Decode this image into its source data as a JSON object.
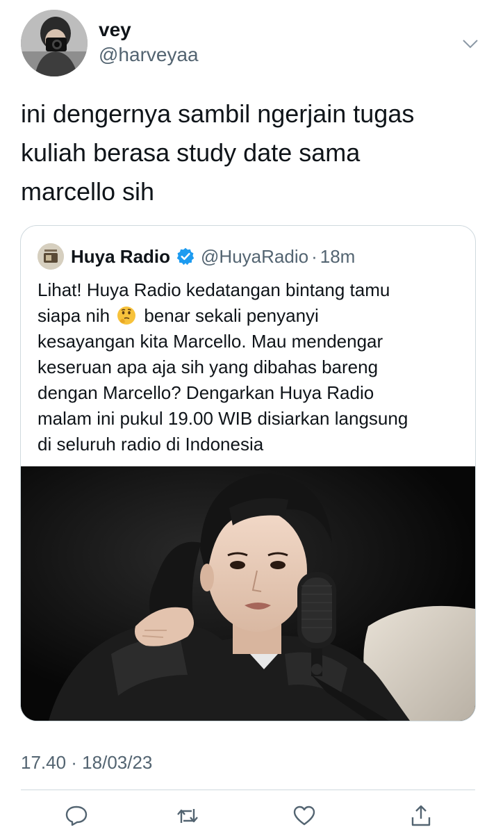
{
  "author": {
    "display_name": "vey",
    "handle": "@harveyaa"
  },
  "icons": {
    "more": "chevron-down-icon",
    "verified": "verified-badge-icon",
    "reply": "reply-icon",
    "retweet": "retweet-icon",
    "like": "heart-icon",
    "share": "share-icon"
  },
  "tweet": {
    "text": "ini dengernya sambil ngerjain tugas\nkuliah berasa study date sama\nmarcello sih",
    "timestamp": "17.40 · 18/03/23"
  },
  "quote": {
    "name": "Huya Radio",
    "handle": "@HuyaRadio",
    "separator": "·",
    "time": "18m",
    "lines": {
      "l1": "Lihat! Huya Radio kedatangan bintang tamu",
      "l2a": "siapa nih",
      "l2b": "benar sekali penyanyi",
      "l3": "kesayangan kita Marcello. Mau mendengar",
      "l4": "keseruan apa aja sih yang dibahas bareng",
      "l5": "dengan Marcello? Dengarkan Huya Radio",
      "l6": "malam ini pukul 19.00 WIB disiarkan langsung",
      "l7": "di seluruh radio di Indonesia"
    },
    "emoji": "thinking-face"
  },
  "colors": {
    "text_primary": "#0f1419",
    "text_secondary": "#536471",
    "border": "#cfd9de",
    "verified_blue": "#1d9bf0"
  }
}
